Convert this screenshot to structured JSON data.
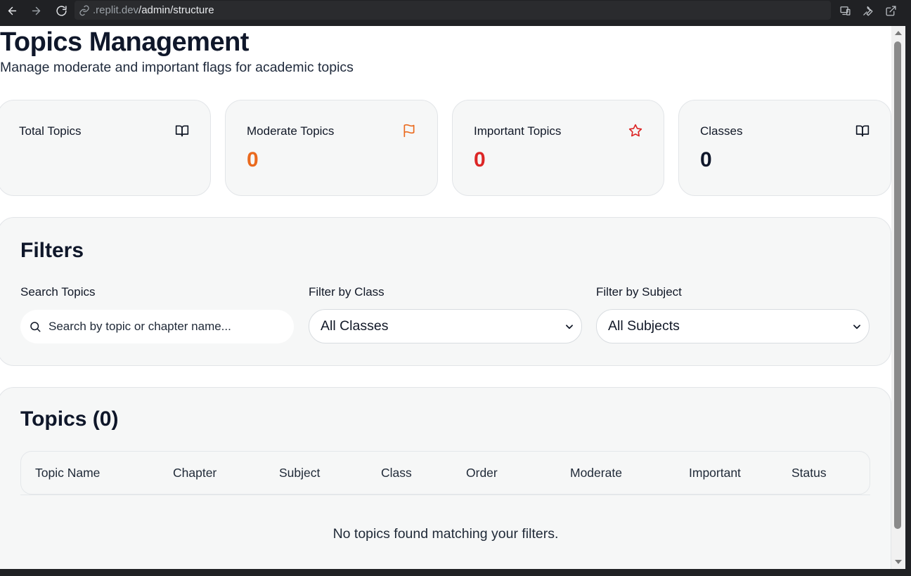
{
  "browser": {
    "url_host": ".replit.dev",
    "url_path": "/admin/structure"
  },
  "page": {
    "title": "Topics Management",
    "subtitle": "Manage moderate and important flags for academic topics"
  },
  "stats": [
    {
      "label": "Total Topics",
      "value": "",
      "icon": "book-open-icon",
      "color": "#111827"
    },
    {
      "label": "Moderate Topics",
      "value": "0",
      "icon": "flag-icon",
      "color": "#ea6a1e"
    },
    {
      "label": "Important Topics",
      "value": "0",
      "icon": "star-icon",
      "color": "#dc2626"
    },
    {
      "label": "Classes",
      "value": "0",
      "icon": "book-open-icon",
      "color": "#0f172a"
    }
  ],
  "filters": {
    "title": "Filters",
    "search_label": "Search Topics",
    "search_placeholder": "Search by topic or chapter name...",
    "class_label": "Filter by Class",
    "class_value": "All Classes",
    "subject_label": "Filter by Subject",
    "subject_value": "All Subjects"
  },
  "topics": {
    "title": "Topics (0)",
    "columns": [
      "Topic Name",
      "Chapter",
      "Subject",
      "Class",
      "Order",
      "Moderate",
      "Important",
      "Status"
    ],
    "empty_message": "No topics found matching your filters."
  },
  "colors": {
    "moderate": "#ea6a1e",
    "important": "#dc2626"
  }
}
